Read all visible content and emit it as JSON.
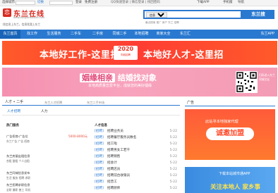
{
  "topbar": {
    "city_label": "选择城市：",
    "switch_label": "切换",
    "login_label": "登录",
    "register_label": "免费注册",
    "notice": "QQ快速登录 | 微信登录 | 找回密码",
    "download_app": "下载APP",
    "mobile": "手机版",
    "nav_label": "导航"
  },
  "header": {
    "logo_char": "恋",
    "logo_text": "东兰在线",
    "logo_url": "www.donglanzaixian.com",
    "slogan": "找信息上东兰，信息找我上东兰"
  },
  "search": {
    "select_value": "信息频道",
    "button_label": "东兰搜",
    "hotwords": "最近搜索 推广 房产 东兰 招聘"
  },
  "nav": {
    "items": [
      "东兰首页",
      "找工作",
      "生活服务",
      "二手车",
      "二手房",
      "同城二手",
      "本地招聘",
      "商家大全",
      "东兰汇"
    ],
    "app_label": "东兰APP"
  },
  "banner1": {
    "left_text": "本地好工作-这里找",
    "badge_year": "2020",
    "badge_sub": "同城招聘",
    "right_text": "本地好人才-这里招"
  },
  "banner2": {
    "title_highlight": "姻缘相亲",
    "title_rest": "结婚找对象",
    "subtitle": "本地高质量恋爱平台，成就您的美好姻缘",
    "qr_caption": "扫码进入东兰同城交友"
  },
  "tabs": {
    "items": [
      "人才 • 二手",
      "东兰人才招聘",
      "东兰二手市场"
    ],
    "sub_items": [
      "人才招聘",
      "人力"
    ]
  },
  "left_section": {
    "head": "热门服务",
    "rows": [
      {
        "title": "广告招商·广告位",
        "sub": "东兰广告 广告 招商",
        "price": "5000-8000元"
      },
      {
        "title": "东兰房屋出租信息",
        "sub": "合租 整租 个人出租",
        "price": ""
      },
      {
        "title": "东兰同城信息发布",
        "sub": "生活 服务 招聘 求职",
        "price": ""
      },
      {
        "title": "东兰招聘求职信息",
        "sub": "全职 兼职 普工 司机",
        "price": ""
      }
    ]
  },
  "right_section": {
    "head": "人才信息",
    "rows": [
      {
        "tag": "[招聘]",
        "text": "招聘业务员",
        "date": "5-22"
      },
      {
        "tag": "[招聘]",
        "text": "招聘餐厅服务员数名",
        "date": "5-22"
      },
      {
        "tag": "[招聘]",
        "text": "招工啦",
        "date": "5-22"
      },
      {
        "tag": "[招聘]",
        "text": "招聘男女工若干",
        "date": "5-22"
      },
      {
        "tag": "[招聘]",
        "text": "招聘销售",
        "date": "5-22"
      },
      {
        "tag": "[招聘]",
        "text": "招会计",
        "date": "5-22"
      },
      {
        "tag": "[招聘]",
        "text": "招聘店员",
        "date": "5-22"
      },
      {
        "tag": "[招聘]",
        "text": "招聘前台收银员",
        "date": "5-22"
      },
      {
        "tag": "[招聘]",
        "text": "招普工",
        "date": "5-22"
      },
      {
        "tag": "[招聘]",
        "text": "招聘厨师",
        "date": "5-22"
      }
    ]
  },
  "sidebar": {
    "head": "广告",
    "ad1_text": "此站寻本地独家代理",
    "ad1_pill": "诚邀加盟",
    "ad2_text": "下载本站城市通APP",
    "ad2_big": "关注本地人 家乡事"
  },
  "colors": {
    "brand_blue": "#2a79d0",
    "brand_red": "#d8281f",
    "banner_red": "#ff3d33",
    "banner_pink": "#f8a3bd"
  }
}
